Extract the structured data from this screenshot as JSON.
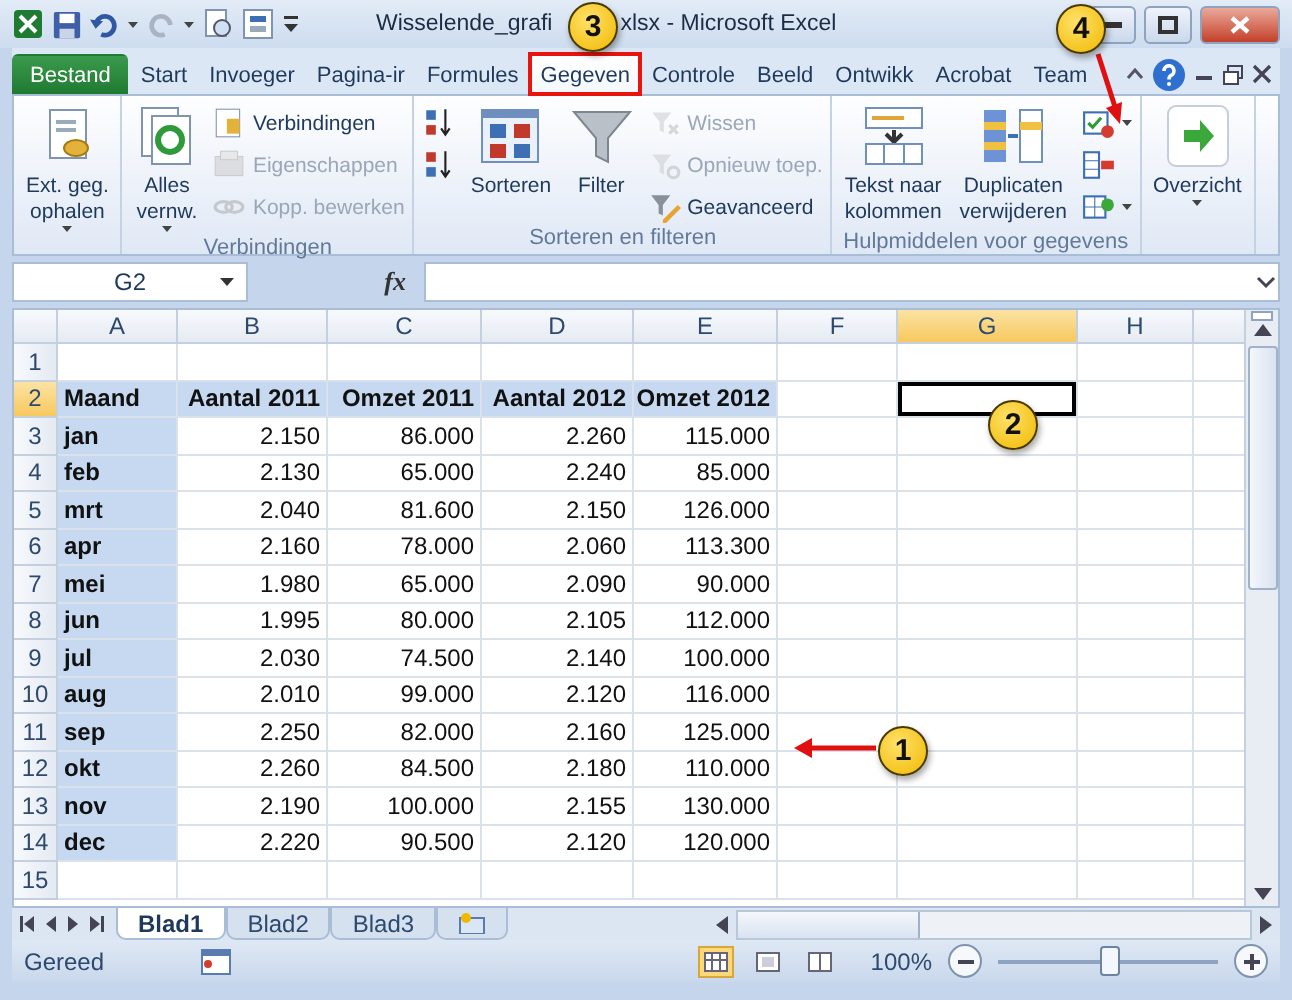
{
  "window": {
    "title_start": "Wisselende_grafi",
    "title_end": "xlsx - Microsoft Excel"
  },
  "tabs": [
    {
      "label": "Bestand",
      "kind": "file",
      "selected": false,
      "outlined": false
    },
    {
      "label": "Start",
      "kind": "tab",
      "selected": false,
      "outlined": false
    },
    {
      "label": "Invoeger",
      "kind": "tab",
      "selected": false,
      "outlined": false
    },
    {
      "label": "Pagina-ir",
      "kind": "tab",
      "selected": false,
      "outlined": false
    },
    {
      "label": "Formules",
      "kind": "tab",
      "selected": false,
      "outlined": false
    },
    {
      "label": "Gegeven",
      "kind": "tab",
      "selected": true,
      "outlined": true
    },
    {
      "label": "Controle",
      "kind": "tab",
      "selected": false,
      "outlined": false
    },
    {
      "label": "Beeld",
      "kind": "tab",
      "selected": false,
      "outlined": false
    },
    {
      "label": "Ontwikk",
      "kind": "tab",
      "selected": false,
      "outlined": false
    },
    {
      "label": "Acrobat",
      "kind": "tab",
      "selected": false,
      "outlined": false
    },
    {
      "label": "Team",
      "kind": "tab",
      "selected": false,
      "outlined": false
    }
  ],
  "ribbon": {
    "groups": [
      {
        "items": [
          {
            "kind": "large",
            "label": "Ext. geg.\nophalen",
            "dropdown": true,
            "disabled": false
          }
        ]
      },
      {
        "label": "Verbindingen",
        "items": [
          {
            "kind": "large",
            "label": "Alles\nvernw.",
            "dropdown": true,
            "disabled": false
          },
          {
            "kind": "stack",
            "items": [
              {
                "label": "Verbindingen",
                "disabled": false,
                "dropdown": false
              },
              {
                "label": "Eigenschappen",
                "disabled": true,
                "dropdown": false
              },
              {
                "label": "Kopp. bewerken",
                "disabled": true,
                "dropdown": false
              }
            ]
          }
        ]
      },
      {
        "label": "Sorteren en filteren",
        "items": [
          {
            "kind": "stack",
            "items": [
              {
                "disabled": false,
                "dropdown": false
              },
              {
                "disabled": false,
                "dropdown": false
              }
            ]
          },
          {
            "kind": "large",
            "label": "Sorteren",
            "dropdown": false,
            "disabled": false
          },
          {
            "kind": "large",
            "label": "Filter",
            "dropdown": false,
            "disabled": false
          },
          {
            "kind": "stack",
            "items": [
              {
                "label": "Wissen",
                "disabled": true,
                "dropdown": false
              },
              {
                "label": "Opnieuw toep.",
                "disabled": true,
                "dropdown": false
              },
              {
                "label": "Geavanceerd",
                "disabled": false,
                "dropdown": false
              }
            ]
          }
        ]
      },
      {
        "label": "Hulpmiddelen voor gegevens",
        "items": [
          {
            "kind": "large",
            "label": "Tekst naar\nkolommen",
            "dropdown": false,
            "disabled": false
          },
          {
            "kind": "large",
            "label": "Duplicaten\nverwijderen",
            "dropdown": false,
            "disabled": false
          },
          {
            "kind": "stack",
            "items": [
              {
                "disabled": false,
                "dropdown": true
              },
              {
                "disabled": false,
                "dropdown": false
              },
              {
                "disabled": false,
                "dropdown": true
              }
            ]
          }
        ]
      },
      {
        "items": [
          {
            "kind": "large",
            "label": "Overzicht",
            "dropdown": true,
            "disabled": false
          }
        ]
      }
    ]
  },
  "formula_bar": {
    "name_box": "G2",
    "function_label": "fx"
  },
  "sheet": {
    "columns": [
      {
        "label": "A",
        "selected": false
      },
      {
        "label": "B",
        "selected": false
      },
      {
        "label": "C",
        "selected": false
      },
      {
        "label": "D",
        "selected": false
      },
      {
        "label": "E",
        "selected": false
      },
      {
        "label": "F",
        "selected": false
      },
      {
        "label": "G",
        "selected": true
      },
      {
        "label": "H",
        "selected": false
      }
    ],
    "rows": [
      {
        "number": "1",
        "selected": false,
        "cells": []
      },
      {
        "number": "2",
        "selected": true,
        "cells": [
          {
            "v": "Maand",
            "kind": "label",
            "shaded": true
          },
          {
            "v": "Aantal 2011",
            "kind": "label",
            "shaded": true
          },
          {
            "v": "Omzet 2011",
            "kind": "label",
            "shaded": true
          },
          {
            "v": "Aantal 2012",
            "kind": "label",
            "shaded": true
          },
          {
            "v": "Omzet 2012",
            "kind": "label",
            "shaded": true
          }
        ]
      },
      {
        "number": "3",
        "selected": false,
        "cells": [
          {
            "v": "jan",
            "kind": "label",
            "shaded": true
          },
          {
            "v": "2.150",
            "kind": "number",
            "shaded": false
          },
          {
            "v": "86.000",
            "kind": "number",
            "shaded": false
          },
          {
            "v": "2.260",
            "kind": "number",
            "shaded": false
          },
          {
            "v": "115.000",
            "kind": "number",
            "shaded": false
          }
        ]
      },
      {
        "number": "4",
        "selected": false,
        "cells": [
          {
            "v": "feb",
            "kind": "label",
            "shaded": true
          },
          {
            "v": "2.130",
            "kind": "number",
            "shaded": false
          },
          {
            "v": "65.000",
            "kind": "number",
            "shaded": false
          },
          {
            "v": "2.240",
            "kind": "number",
            "shaded": false
          },
          {
            "v": "85.000",
            "kind": "number",
            "shaded": false
          }
        ]
      },
      {
        "number": "5",
        "selected": false,
        "cells": [
          {
            "v": "mrt",
            "kind": "label",
            "shaded": true
          },
          {
            "v": "2.040",
            "kind": "number",
            "shaded": false
          },
          {
            "v": "81.600",
            "kind": "number",
            "shaded": false
          },
          {
            "v": "2.150",
            "kind": "number",
            "shaded": false
          },
          {
            "v": "126.000",
            "kind": "number",
            "shaded": false
          }
        ]
      },
      {
        "number": "6",
        "selected": false,
        "cells": [
          {
            "v": "apr",
            "kind": "label",
            "shaded": true
          },
          {
            "v": "2.160",
            "kind": "number",
            "shaded": false
          },
          {
            "v": "78.000",
            "kind": "number",
            "shaded": false
          },
          {
            "v": "2.060",
            "kind": "number",
            "shaded": false
          },
          {
            "v": "113.300",
            "kind": "number",
            "shaded": false
          }
        ]
      },
      {
        "number": "7",
        "selected": false,
        "cells": [
          {
            "v": "mei",
            "kind": "label",
            "shaded": true
          },
          {
            "v": "1.980",
            "kind": "number",
            "shaded": false
          },
          {
            "v": "65.000",
            "kind": "number",
            "shaded": false
          },
          {
            "v": "2.090",
            "kind": "number",
            "shaded": false
          },
          {
            "v": "90.000",
            "kind": "number",
            "shaded": false
          }
        ]
      },
      {
        "number": "8",
        "selected": false,
        "cells": [
          {
            "v": "jun",
            "kind": "label",
            "shaded": true
          },
          {
            "v": "1.995",
            "kind": "number",
            "shaded": false
          },
          {
            "v": "80.000",
            "kind": "number",
            "shaded": false
          },
          {
            "v": "2.105",
            "kind": "number",
            "shaded": false
          },
          {
            "v": "112.000",
            "kind": "number",
            "shaded": false
          }
        ]
      },
      {
        "number": "9",
        "selected": false,
        "cells": [
          {
            "v": "jul",
            "kind": "label",
            "shaded": true
          },
          {
            "v": "2.030",
            "kind": "number",
            "shaded": false
          },
          {
            "v": "74.500",
            "kind": "number",
            "shaded": false
          },
          {
            "v": "2.140",
            "kind": "number",
            "shaded": false
          },
          {
            "v": "100.000",
            "kind": "number",
            "shaded": false
          }
        ]
      },
      {
        "number": "10",
        "selected": false,
        "cells": [
          {
            "v": "aug",
            "kind": "label",
            "shaded": true
          },
          {
            "v": "2.010",
            "kind": "number",
            "shaded": false
          },
          {
            "v": "99.000",
            "kind": "number",
            "shaded": false
          },
          {
            "v": "2.120",
            "kind": "number",
            "shaded": false
          },
          {
            "v": "116.000",
            "kind": "number",
            "shaded": false
          }
        ]
      },
      {
        "number": "11",
        "selected": false,
        "cells": [
          {
            "v": "sep",
            "kind": "label",
            "shaded": true
          },
          {
            "v": "2.250",
            "kind": "number",
            "shaded": false
          },
          {
            "v": "82.000",
            "kind": "number",
            "shaded": false
          },
          {
            "v": "2.160",
            "kind": "number",
            "shaded": false
          },
          {
            "v": "125.000",
            "kind": "number",
            "shaded": false
          }
        ]
      },
      {
        "number": "12",
        "selected": false,
        "cells": [
          {
            "v": "okt",
            "kind": "label",
            "shaded": true
          },
          {
            "v": "2.260",
            "kind": "number",
            "shaded": false
          },
          {
            "v": "84.500",
            "kind": "number",
            "shaded": false
          },
          {
            "v": "2.180",
            "kind": "number",
            "shaded": false
          },
          {
            "v": "110.000",
            "kind": "number",
            "shaded": false
          }
        ]
      },
      {
        "number": "13",
        "selected": false,
        "cells": [
          {
            "v": "nov",
            "kind": "label",
            "shaded": true
          },
          {
            "v": "2.190",
            "kind": "number",
            "shaded": false
          },
          {
            "v": "100.000",
            "kind": "number",
            "shaded": false
          },
          {
            "v": "2.155",
            "kind": "number",
            "shaded": false
          },
          {
            "v": "130.000",
            "kind": "number",
            "shaded": false
          }
        ]
      },
      {
        "number": "14",
        "selected": false,
        "cells": [
          {
            "v": "dec",
            "kind": "label",
            "shaded": true
          },
          {
            "v": "2.220",
            "kind": "number",
            "shaded": false
          },
          {
            "v": "90.500",
            "kind": "number",
            "shaded": false
          },
          {
            "v": "2.120",
            "kind": "number",
            "shaded": false
          },
          {
            "v": "120.000",
            "kind": "number",
            "shaded": false
          }
        ]
      },
      {
        "number": "15",
        "selected": false,
        "cells": []
      }
    ]
  },
  "sheet_tabs": [
    {
      "label": "Blad1",
      "selected": true
    },
    {
      "label": "Blad2",
      "selected": false
    },
    {
      "label": "Blad3",
      "selected": false
    }
  ],
  "status_bar": {
    "text": "Gereed",
    "views": [
      {
        "selected": true
      },
      {
        "selected": false
      },
      {
        "selected": false
      }
    ],
    "zoom": "100%",
    "zoom_slider": {
      "level": 0.5
    }
  },
  "callouts": [
    {
      "number": "1"
    },
    {
      "number": "2"
    },
    {
      "number": "3"
    },
    {
      "number": "4"
    }
  ]
}
